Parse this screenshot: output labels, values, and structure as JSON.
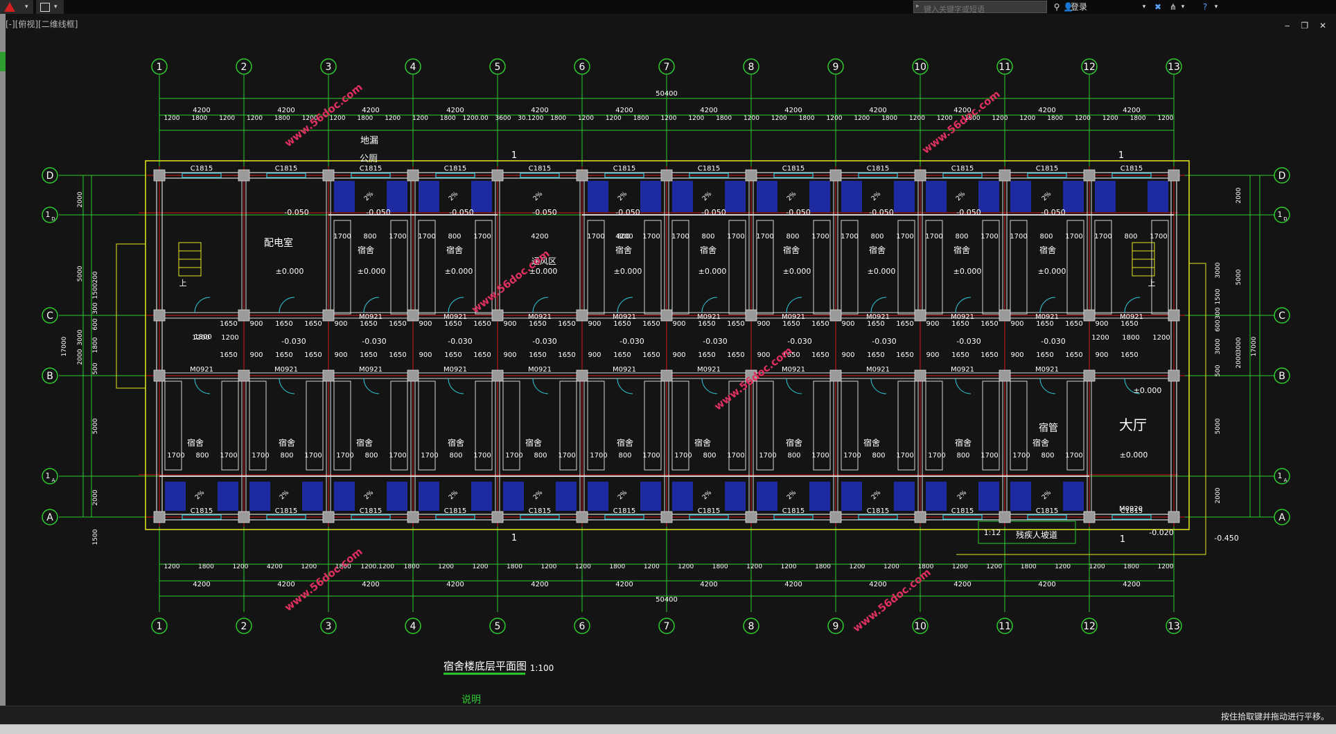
{
  "app": {
    "search_placeholder": "键入关键字或短语",
    "login_label": "登录",
    "viewport_label": "[-][俯视][二维线框]",
    "window_controls": "‒ ❐ ✕",
    "status_message": "按住拾取键并拖动进行平移。"
  },
  "colors": {
    "background": "#141414",
    "axis_green": "#2ecc2e",
    "wall_white": "#d8d8d8",
    "column_gray": "#9a9a9a",
    "red_line": "#d01818",
    "yellow": "#e6e61e",
    "cyan": "#2ec8d8",
    "blue_fixture": "#1e2eb8",
    "watermark": "#e03060"
  },
  "icons": [
    "app-logo-icon",
    "save-icon",
    "binoculars-icon",
    "user-icon",
    "exchange-icon",
    "network-icon",
    "help-icon",
    "minimize-icon",
    "restore-icon",
    "close-icon"
  ],
  "drawing": {
    "title": "宿舍楼底层平面图",
    "scale": "1:100",
    "notes_heading": "说明",
    "axis_numbers": [
      "1",
      "2",
      "3",
      "4",
      "5",
      "6",
      "7",
      "8",
      "9",
      "10",
      "11",
      "12",
      "13"
    ],
    "axis_letters": [
      "D",
      "1/D",
      "C",
      "B",
      "1/A",
      "A"
    ],
    "overall_width": "50400",
    "overall_depth": "17000",
    "bay_dim": "4200",
    "top_sub_dims": [
      "1200",
      "1800",
      "1200",
      "1200",
      "1800",
      "1200",
      "1200",
      "1800",
      "1200",
      "1200",
      "1800",
      "1200.00",
      "3600",
      "30.1200",
      "1800",
      "1200",
      "1200",
      "1800",
      "1200",
      "1200",
      "1800",
      "1200",
      "1200",
      "1800",
      "1200",
      "1200",
      "1800",
      "1200",
      "1200",
      "1800",
      "1200",
      "1200",
      "1800",
      "1200",
      "1200",
      "1800",
      "1200"
    ],
    "bottom_sub_dims": [
      "1200",
      "1800",
      "1200",
      "4200",
      "1200",
      "1800",
      "1200.1200",
      "1800",
      "1200",
      "1200",
      "1800",
      "1200",
      "1200",
      "1800",
      "1200",
      "1200",
      "1800",
      "1200",
      "1200",
      "1800",
      "1200",
      "1200",
      "1800",
      "1200",
      "1200",
      "1800",
      "1200",
      "1200",
      "1800",
      "1200"
    ],
    "left_dims": [
      "2000",
      "5000",
      "3000",
      "2000",
      "17000",
      "200",
      "1500",
      "300",
      "600",
      "1800",
      "500",
      "5000",
      "2000",
      "1500"
    ],
    "right_dims": [
      "2000",
      "5000",
      "3000",
      "2000",
      "17000",
      "3000",
      "1500",
      "300",
      "600",
      "3000",
      "500",
      "5000",
      "2000"
    ],
    "rooms": {
      "distribution_room": "配电室",
      "dorm": "宿舍",
      "ventilation": "通风区",
      "manager": "宿管",
      "hall": "大厅",
      "floor_drain": "地漏",
      "toilet": "公厕"
    },
    "door_code": "M0921",
    "entry_door_code": "M0920",
    "window_code": "C1815",
    "levels": {
      "zero": "±0.000",
      "corridor": "-0.030",
      "wet": "-0.050",
      "outside": "-0.450",
      "step": "-0.020"
    },
    "room_dims": [
      "1700",
      "800",
      "1700"
    ],
    "corridor_dims": [
      "1650",
      "900",
      "1650"
    ],
    "slope_text": "2%",
    "ramp_text": "1:12",
    "ramp_label": "残疾人坡道",
    "stair_label": "上",
    "section_mark": "1",
    "misc_dims": [
      "1200",
      "1800",
      "1200",
      "1600",
      "1800",
      "1600",
      "1500",
      "300",
      "300",
      "600",
      "1620",
      "300",
      "300"
    ],
    "watermark": "www.56doc.com"
  }
}
